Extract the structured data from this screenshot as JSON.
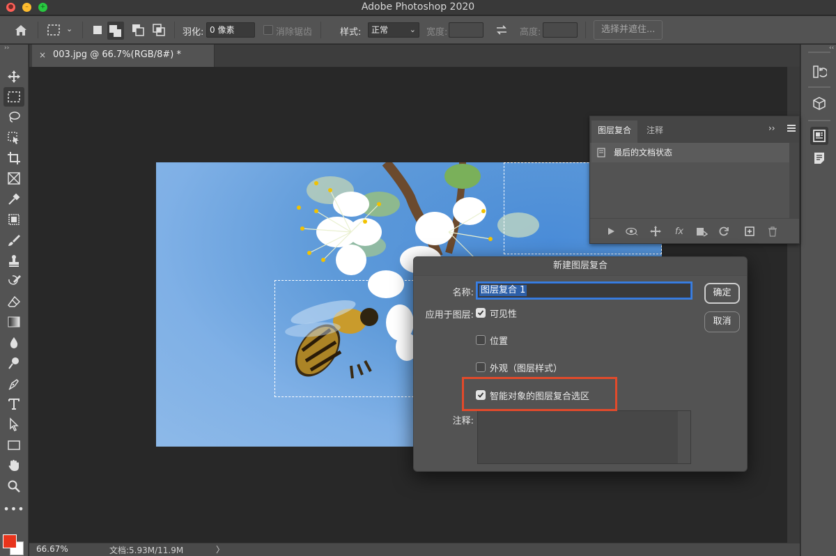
{
  "window": {
    "title": "Adobe Photoshop 2020"
  },
  "options_bar": {
    "feather_label": "羽化:",
    "feather_value": "0 像素",
    "antialias_label": "消除锯齿",
    "style_label": "样式:",
    "style_value": "正常",
    "width_label": "宽度:",
    "height_label": "高度:",
    "select_mask_button": "选择并遮住..."
  },
  "document_tab": {
    "title": "003.jpg @ 66.7%(RGB/8#) *",
    "close_symbol": "×"
  },
  "layer_comps_panel": {
    "tabs": [
      "图层复合",
      "注释"
    ],
    "active_tab": "图层复合",
    "rows": [
      {
        "label": "最后的文档状态"
      }
    ]
  },
  "dialog": {
    "title": "新建图层复合",
    "name_label": "名称:",
    "name_value": "图层复合 1",
    "apply_label": "应用于图层:",
    "options": [
      {
        "label": "可见性",
        "checked": true
      },
      {
        "label": "位置",
        "checked": false
      },
      {
        "label": "外观（图层样式）",
        "checked": false
      },
      {
        "label": "智能对象的图层复合选区",
        "checked": true
      }
    ],
    "notes_label": "注释:",
    "notes_value": "",
    "ok_button": "确定",
    "cancel_button": "取消"
  },
  "status_bar": {
    "zoom": "66.67%",
    "doc_info": "文档:5.93M/11.9M",
    "arrow": "〉"
  },
  "colors": {
    "foreground": "#e8341c",
    "background": "#ffffff",
    "highlight": "#e24a2b"
  }
}
